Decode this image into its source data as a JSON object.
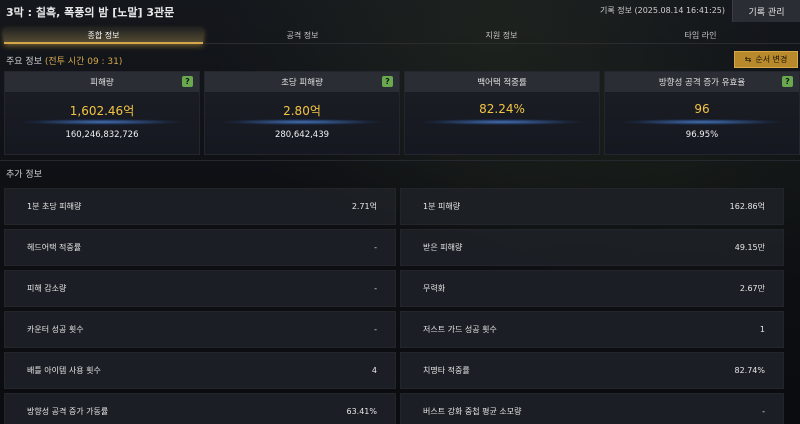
{
  "header": {
    "title": "3막 : 칠흑, 폭풍의 밤 [노말]  3관문",
    "record_info": "기록 정보 (2025.08.14 16:41:25)",
    "record_manage": "기록 관리"
  },
  "tabs": [
    {
      "label": "종합 정보",
      "active": true
    },
    {
      "label": "공격 정보",
      "active": false
    },
    {
      "label": "지원 정보",
      "active": false
    },
    {
      "label": "타임 라인",
      "active": false
    }
  ],
  "main_info": {
    "label": "주요 정보",
    "battle_time": "(전투 시간 09 : 31)",
    "order_button": "순서 변경",
    "order_icon": "⇆"
  },
  "stats": [
    {
      "title": "피해량",
      "main": "1,602.46억",
      "sub": "160,246,832,726"
    },
    {
      "title": "초당 피해량",
      "main": "2.80억",
      "sub": "280,642,439"
    },
    {
      "title": "백어택 적중률",
      "main": "82.24%",
      "sub": ""
    },
    {
      "title": "방향성 공격 증가 유효율",
      "main": "96",
      "sub": "96.95%"
    }
  ],
  "help_icon": "?",
  "extra_info": {
    "label": "추가 정보",
    "rows": [
      {
        "label": "1분 초당 피해량",
        "value": "2.71억"
      },
      {
        "label": "1분 피해량",
        "value": "162.86억"
      },
      {
        "label": "헤드어택 적중률",
        "value": "-"
      },
      {
        "label": "받은 피해량",
        "value": "49.15만"
      },
      {
        "label": "피해 감소량",
        "value": "-"
      },
      {
        "label": "무력화",
        "value": "2.67만"
      },
      {
        "label": "카운터 성공 횟수",
        "value": "-"
      },
      {
        "label": "저스트 가드 성공 횟수",
        "value": "1"
      },
      {
        "label": "배틀 아이템 사용 횟수",
        "value": "4"
      },
      {
        "label": "치명타 적중률",
        "value": "82.74%"
      },
      {
        "label": "방향성 공격 증가 가동률",
        "value": "63.41%"
      },
      {
        "label": "버스트 강화 중첩 평균 소모량",
        "value": "-"
      }
    ]
  }
}
